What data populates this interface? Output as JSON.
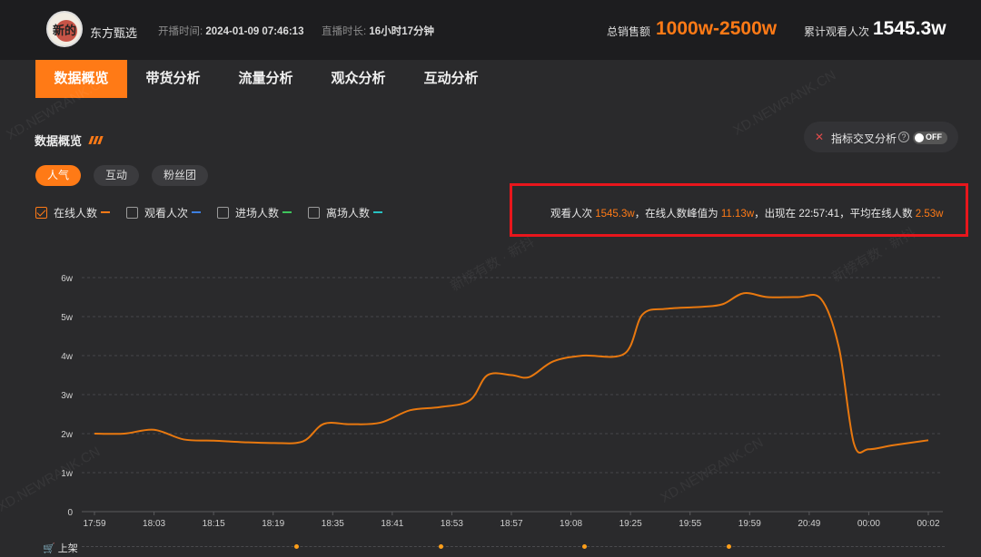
{
  "header": {
    "avatar_text": "新的",
    "shop_name": "东方甄选",
    "start_label": "开播时间:",
    "start_value": "2024-01-09 07:46:13",
    "duration_label": "直播时长:",
    "duration_value": "16小时17分钟",
    "sales_label": "总销售额",
    "sales_value": "1000w-2500w",
    "views_label": "累计观看人次",
    "views_value": "1545.3w"
  },
  "tabs": [
    {
      "label": "数据概览",
      "active": true
    },
    {
      "label": "带货分析",
      "active": false
    },
    {
      "label": "流量分析",
      "active": false
    },
    {
      "label": "观众分析",
      "active": false
    },
    {
      "label": "互动分析",
      "active": false
    }
  ],
  "section": {
    "title": "数据概览",
    "cross_icon": "cross-analysis-icon",
    "cross_label": "指标交叉分析",
    "toggle_label": "OFF"
  },
  "pills": [
    {
      "label": "人气",
      "active": true
    },
    {
      "label": "互动",
      "active": false
    },
    {
      "label": "粉丝团",
      "active": false
    }
  ],
  "metrics": [
    {
      "label": "在线人数",
      "checked": true,
      "color": "#ff7a16"
    },
    {
      "label": "观看人次",
      "checked": false,
      "color": "#3d7fe0"
    },
    {
      "label": "进场人数",
      "checked": false,
      "color": "#3ec45c"
    },
    {
      "label": "离场人数",
      "checked": false,
      "color": "#27c2c2"
    }
  ],
  "summary": {
    "p1": "观看人次 ",
    "v1": "1545.3w",
    "p2": "，在线人数峰值为 ",
    "v2": "11.13w",
    "p3": "，出现在 22:57:41，平均在线人数 ",
    "v3": "2.53w"
  },
  "watermarks": [
    "XD.NEWRANK.CN",
    "新榜有数 · 新抖",
    "XD.NEWRANK.CN",
    "新榜有数 · 新抖",
    "XD.NEWRANK.CN",
    "XD.NEWRANK.CN"
  ],
  "chart_data": {
    "type": "line",
    "x": [
      "17:59",
      "18:03",
      "18:15",
      "18:19",
      "18:35",
      "18:41",
      "18:53",
      "18:57",
      "19:08",
      "19:25",
      "19:55",
      "19:59",
      "20:49",
      "00:00",
      "00:02"
    ],
    "yticks": [
      "0",
      "1w",
      "2w",
      "3w",
      "4w",
      "5w",
      "6w"
    ],
    "ylim": [
      0,
      6
    ],
    "series": [
      {
        "color": "#e8780f",
        "values": [
          [
            0,
            2.0
          ],
          [
            0.5,
            2.0
          ],
          [
            1.0,
            2.1
          ],
          [
            1.5,
            1.85
          ],
          [
            2.0,
            1.82
          ],
          [
            2.5,
            1.78
          ],
          [
            3.0,
            1.76
          ],
          [
            3.5,
            1.8
          ],
          [
            3.85,
            2.25
          ],
          [
            4.3,
            2.24
          ],
          [
            4.8,
            2.28
          ],
          [
            5.3,
            2.6
          ],
          [
            5.8,
            2.68
          ],
          [
            6.3,
            2.85
          ],
          [
            6.6,
            3.5
          ],
          [
            7.0,
            3.5
          ],
          [
            7.3,
            3.45
          ],
          [
            7.7,
            3.85
          ],
          [
            8.2,
            4.0
          ],
          [
            8.9,
            4.05
          ],
          [
            9.2,
            5.05
          ],
          [
            9.6,
            5.2
          ],
          [
            10.2,
            5.25
          ],
          [
            10.55,
            5.32
          ],
          [
            10.9,
            5.6
          ],
          [
            11.3,
            5.5
          ],
          [
            11.8,
            5.5
          ],
          [
            12.2,
            5.45
          ],
          [
            12.5,
            4.2
          ],
          [
            12.75,
            1.75
          ],
          [
            13.0,
            1.6
          ],
          [
            13.4,
            1.7
          ],
          [
            14.0,
            1.83
          ]
        ]
      }
    ]
  },
  "launch": {
    "icon": "cart-icon",
    "label": "上架"
  }
}
